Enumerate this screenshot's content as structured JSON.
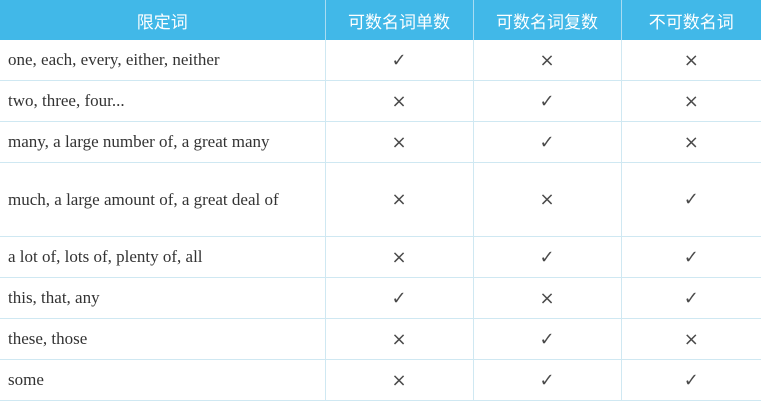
{
  "header": {
    "col1": "限定词",
    "col2": "可数名词单数",
    "col3": "可数名词复数",
    "col4": "不可数名词"
  },
  "rows": [
    {
      "label": "one, each, every, either, neither",
      "c1": "✓",
      "c2": "×",
      "c3": "×"
    },
    {
      "label": "two, three, four...",
      "c1": "×",
      "c2": "✓",
      "c3": "×"
    },
    {
      "label": "many, a large number of, a great many",
      "c1": "×",
      "c2": "✓",
      "c3": "×"
    },
    {
      "label": "much, a large amount of, a great deal of",
      "c1": "×",
      "c2": "×",
      "c3": "✓"
    },
    {
      "label": "a lot of, lots of, plenty of, all",
      "c1": "×",
      "c2": "✓",
      "c3": "✓"
    },
    {
      "label": "this, that, any",
      "c1": "✓",
      "c2": "×",
      "c3": "✓"
    },
    {
      "label": "these, those",
      "c1": "×",
      "c2": "✓",
      "c3": "×"
    },
    {
      "label": "some",
      "c1": "×",
      "c2": "✓",
      "c3": "✓"
    }
  ],
  "colors": {
    "header_bg": "#41b8e8",
    "grid": "#cfe8f2"
  }
}
